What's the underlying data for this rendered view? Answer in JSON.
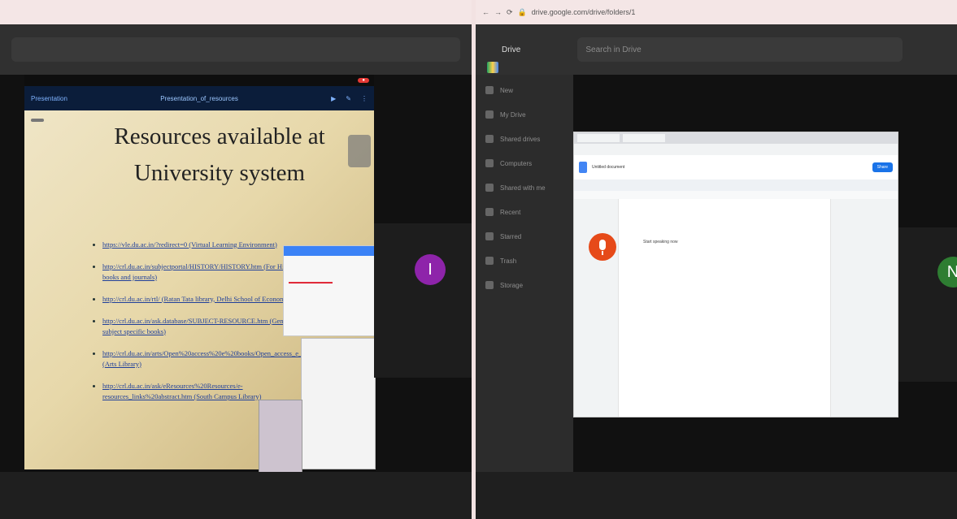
{
  "left_pane": {
    "browser": {
      "title_text": ""
    },
    "drive": {
      "search_placeholder": ""
    },
    "tablet": {
      "status_time": "",
      "toolbar": {
        "left_label": "Presentation",
        "center_title": "Presentation_of_resources"
      }
    },
    "slide": {
      "tag": "",
      "title": "Resources available at University system",
      "items": [
        {
          "text": "https://vle.du.ac.in/?redirect=0 (Virtual Learning Environment)"
        },
        {
          "text": "http://crl.du.ac.in/subjectportal/HISTORY/HISTORY.htm (For History books and journals)"
        },
        {
          "text": "http://crl.du.ac.in/rtl/ (Ratan Tata library, Delhi School of Economics)"
        },
        {
          "text": "http://crl.du.ac.in/ask.database/SUBJECT-RESOURCE.htm (General and subject specific books)"
        },
        {
          "text": "http://crl.du.ac.in/arts/Open%20access%20e%20books/Open_access_e__books.htm (Arts Library)"
        },
        {
          "text": "http://crl.du.ac.in/ask/eResources%20Resources/e-resources_links%20abstract.htm (South Campus Library)"
        }
      ]
    },
    "participant": {
      "initial": "I",
      "color": "#8e24aa",
      "name": ""
    }
  },
  "right_pane": {
    "url": "drive.google.com/drive/folders/1",
    "drive": {
      "brand": "Drive",
      "search_placeholder": "Search in Drive"
    },
    "sidebar": [
      "New",
      "My Drive",
      "Shared drives",
      "Computers",
      "Shared with me",
      "Recent",
      "Starred",
      "Trash",
      "Storage"
    ],
    "docs": {
      "title": "Untitled document",
      "share": "Share",
      "text": "Start speaking now"
    },
    "participant": {
      "initial": "N",
      "color": "#2e7d32",
      "name": ""
    }
  }
}
